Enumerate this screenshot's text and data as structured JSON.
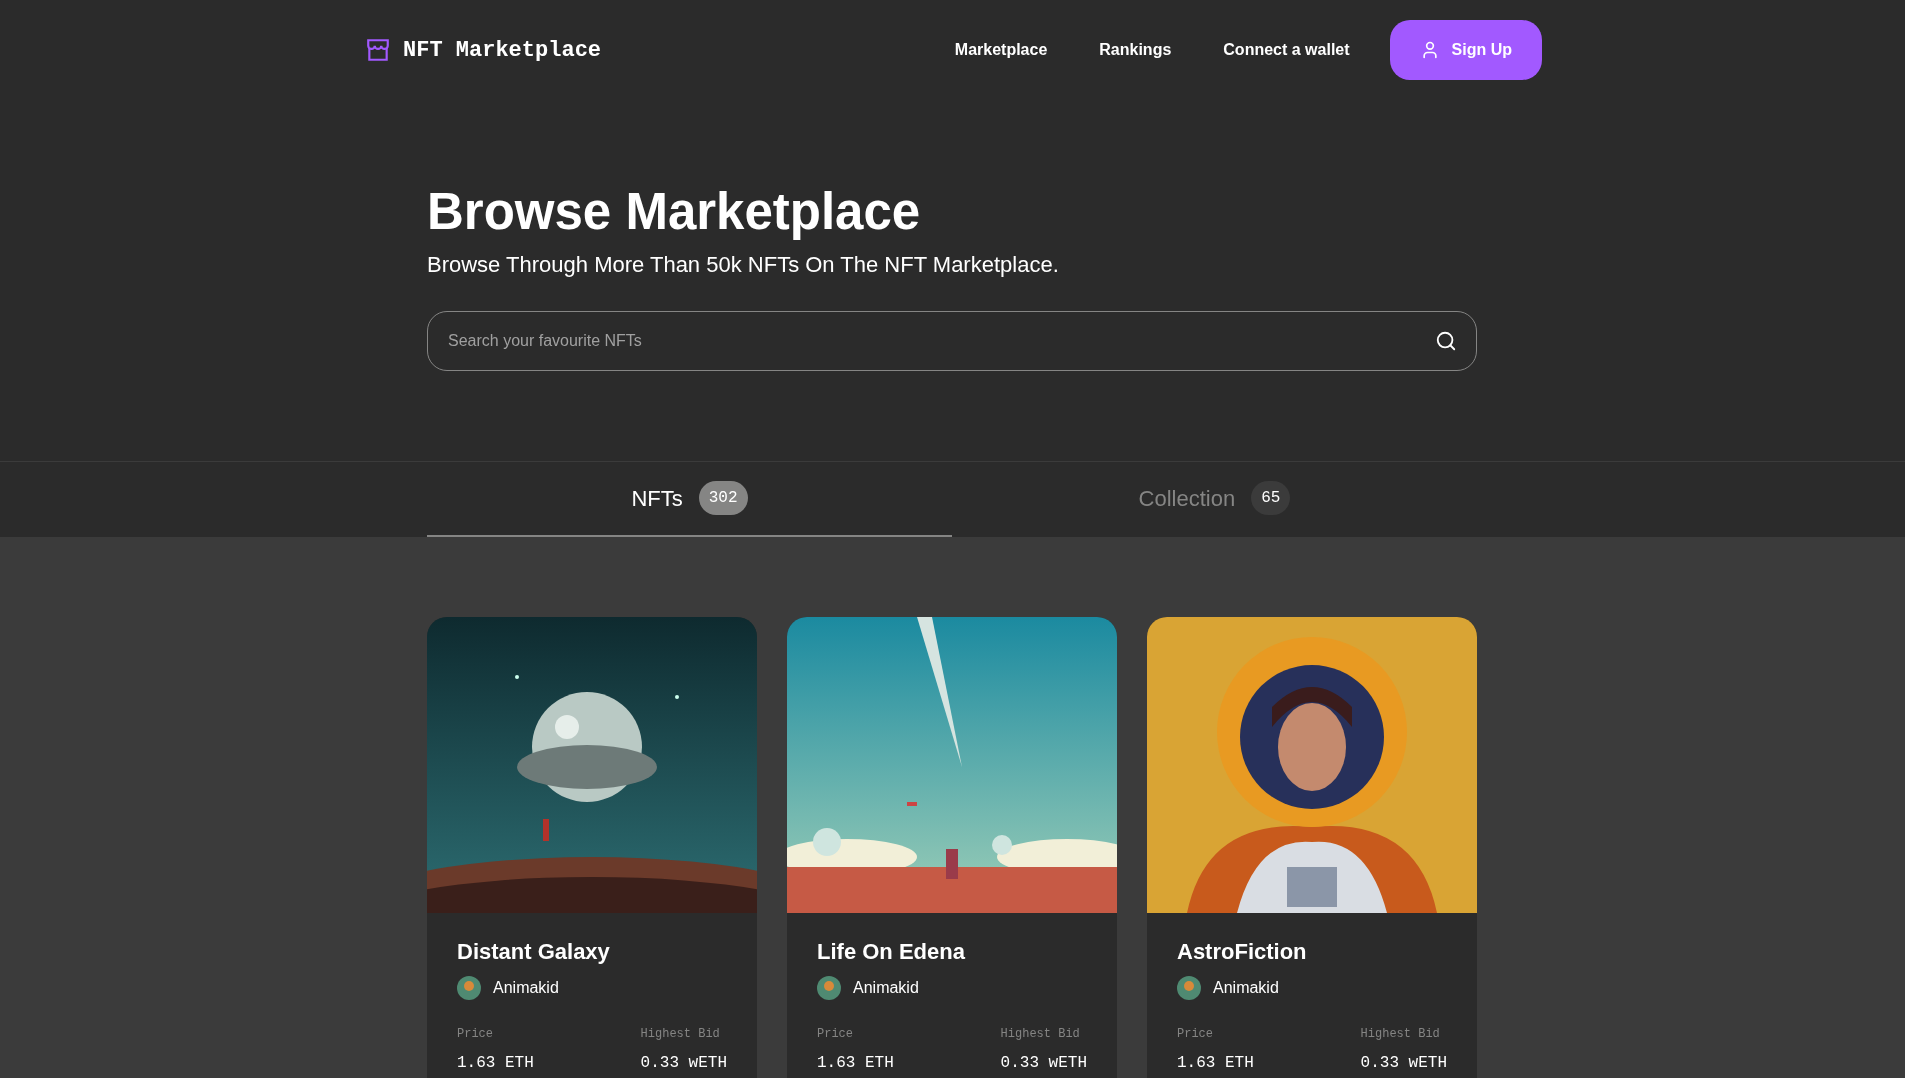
{
  "header": {
    "logo": "NFT Marketplace",
    "nav": [
      "Marketplace",
      "Rankings",
      "Connect a wallet"
    ],
    "signup": "Sign Up"
  },
  "hero": {
    "title": "Browse Marketplace",
    "subtitle": "Browse Through More Than 50k NFTs On The NFT Marketplace.",
    "search": {
      "placeholder": "Search your favourite NFTs"
    }
  },
  "tabs": [
    {
      "label": "NFTs",
      "count": "302",
      "selected": true
    },
    {
      "label": "Collection",
      "count": "65",
      "selected": false
    }
  ],
  "cards": [
    {
      "kind": "picture",
      "title": "Distant Galaxy",
      "artist": "Animakid",
      "price_label": "Price",
      "price": "1.63 ETH",
      "bid_label": "Highest Bid",
      "bid": "0.33 wETH"
    },
    {
      "kind": "picture",
      "title": "Life On Edena",
      "artist": "Animakid",
      "price_label": "Price",
      "price": "1.63 ETH",
      "bid_label": "Highest Bid",
      "bid": "0.33 wETH"
    },
    {
      "kind": "picture",
      "title": "AstroFiction",
      "artist": "Animakid",
      "price_label": "Price",
      "price": "1.63 ETH",
      "bid_label": "Highest Bid",
      "bid": "0.33 wETH"
    }
  ]
}
